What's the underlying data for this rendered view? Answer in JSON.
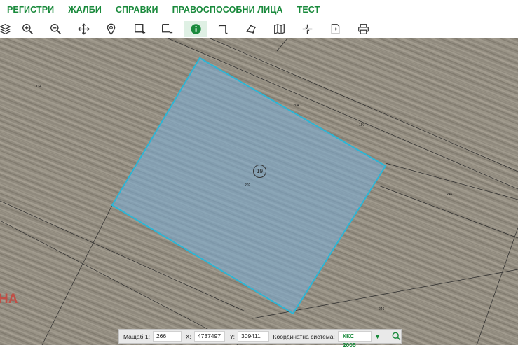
{
  "nav": {
    "items": [
      {
        "label": "РЕГИСТРИ"
      },
      {
        "label": "ЖАЛБИ"
      },
      {
        "label": "СПРАВКИ"
      },
      {
        "label": "ПРАВОСПОСОБНИ ЛИЦА"
      },
      {
        "label": "ТЕСТ"
      }
    ]
  },
  "toolbar": {
    "tools": [
      "layers-icon",
      "zoom-in-icon",
      "zoom-out-icon",
      "pan-icon",
      "location-pin-icon",
      "select-rectangle-icon",
      "select-area-icon",
      "info-icon",
      "measure-distance-icon",
      "measure-polygon-icon",
      "map-icon",
      "split-icon",
      "export-icon",
      "print-icon"
    ],
    "active_tool": "info-icon"
  },
  "map": {
    "parcel_labels": [
      "134",
      "204",
      "197",
      "19",
      "202",
      "246",
      "246"
    ],
    "red_text": "НА",
    "selection_color": "#7aaed8",
    "selection_border": "#2bb6d6"
  },
  "statusbar": {
    "scale_label": "Мащаб 1:",
    "scale_value": "266",
    "x_label": "X:",
    "x_value": "4737497",
    "y_label": "Y:",
    "y_value": "309411",
    "coord_system_label": "Координатна система:",
    "coord_system_value": "ККС 2005"
  },
  "colors": {
    "accent": "#1a8a3c"
  }
}
